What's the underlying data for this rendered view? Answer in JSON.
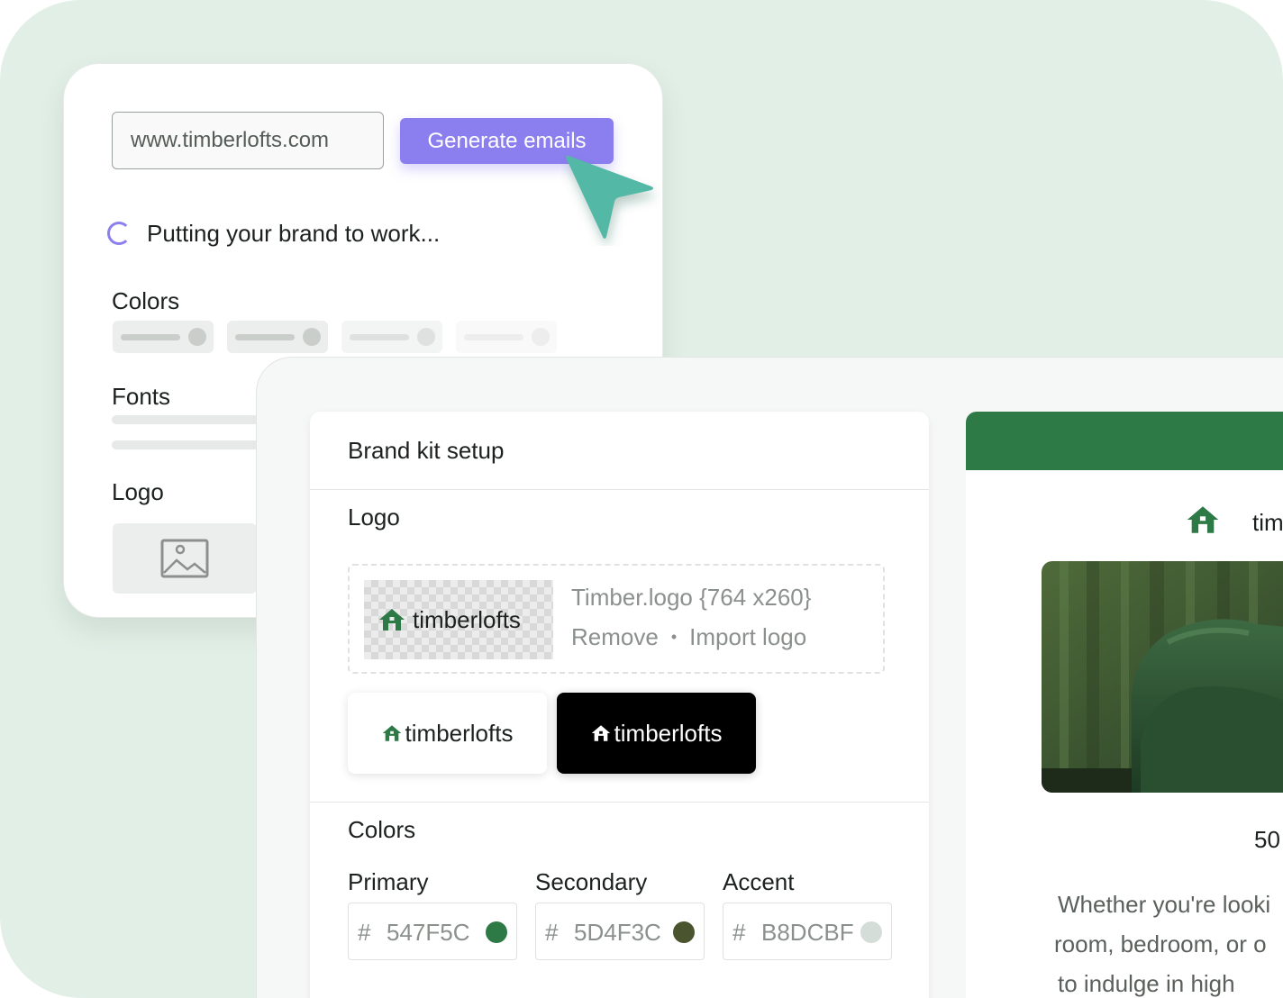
{
  "url_input": {
    "value": "www.timberlofts.com"
  },
  "generate_button": {
    "label": "Generate emails"
  },
  "loading": {
    "text": "Putting your brand to work..."
  },
  "back_sections": {
    "colors": "Colors",
    "fonts": "Fonts",
    "logo": "Logo"
  },
  "brand_kit": {
    "title": "Brand kit setup",
    "logo_section": "Logo",
    "logo_preview_name": "timberlofts",
    "logo_file": "Timber.logo {764 x260}",
    "remove_label": "Remove",
    "separator": "•",
    "import_label": "Import logo",
    "variant_light": "timberlofts",
    "variant_dark": "timberlofts",
    "colors_section": "Colors",
    "colors": [
      {
        "label": "Primary",
        "hash": "#",
        "hex": "547F5C",
        "swatch": "#2e7a47"
      },
      {
        "label": "Secondary",
        "hash": "#",
        "hex": "5D4F3C",
        "swatch": "#4a5530"
      },
      {
        "label": "Accent",
        "hash": "#",
        "hex": "B8DCBF",
        "swatch": "#d5ddd8"
      }
    ]
  },
  "email_preview": {
    "brand_text": "tim",
    "number_text": "50",
    "paragraph_lines": [
      "Whether you're looki",
      "room, bedroom, or o",
      "to indulge in high"
    ],
    "header_color": "#2e7a47"
  },
  "colors": {
    "accent_purple": "#8b7ff0",
    "brand_green": "#2e7a47",
    "cursor_teal": "#52b8a5",
    "background": "#e2efe6"
  }
}
